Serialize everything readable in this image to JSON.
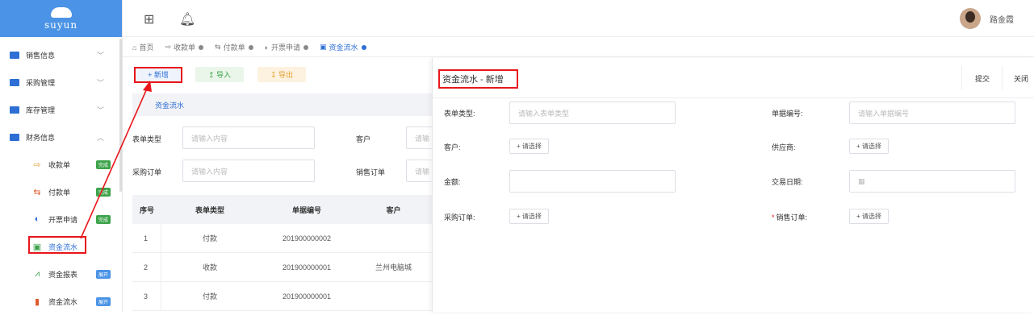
{
  "logo": {
    "text": "suyun"
  },
  "sidebar": {
    "menus": [
      {
        "label": "销售信息",
        "chevron": "﹀"
      },
      {
        "label": "采购管理",
        "chevron": "﹀"
      },
      {
        "label": "库存管理",
        "chevron": "﹀"
      },
      {
        "label": "财务信息",
        "chevron": "︿"
      }
    ],
    "subitems": [
      {
        "label": "收款单",
        "badge": "完成",
        "badge_color": "#3da34a",
        "icon": "receipt-icon",
        "icon_color": "#e3a030"
      },
      {
        "label": "付款单",
        "badge": "完成",
        "badge_color": "#3da34a",
        "icon": "payment-icon",
        "icon_color": "#e05a2b"
      },
      {
        "label": "开票申请",
        "badge": "完成",
        "badge_color": "#3da34a",
        "icon": "invoice-icon",
        "icon_color": "#2d6fd4"
      },
      {
        "label": "资金流水",
        "badge": "",
        "badge_color": "",
        "icon": "flow-icon",
        "icon_color": "#3da34a"
      },
      {
        "label": "资金报表",
        "badge": "展开",
        "badge_color": "#4b93e6",
        "icon": "chart-line-icon",
        "icon_color": "#3da34a"
      },
      {
        "label": "资金流水",
        "badge": "展开",
        "badge_color": "#4b93e6",
        "icon": "chart-bar-icon",
        "icon_color": "#e05a2b"
      }
    ]
  },
  "topbar": {
    "username": "路金霞"
  },
  "tabs": [
    {
      "label": "首页",
      "icon": "⌂",
      "closable": false
    },
    {
      "label": "收款单",
      "icon": "⇨",
      "closable": true
    },
    {
      "label": "付款单",
      "icon": "⇆",
      "closable": true
    },
    {
      "label": "开票申请",
      "icon": "◐",
      "closable": true
    },
    {
      "label": "资金流水",
      "icon": "▣",
      "closable": true,
      "active": true
    }
  ],
  "toolbar": {
    "new_label": "+ 新增",
    "import_label": "↥ 导入",
    "export_label": "↧ 导出"
  },
  "section": {
    "title": "资金流水"
  },
  "filters": {
    "type_label": "表单类型",
    "type_placeholder": "请输入内容",
    "customer_label": "客户",
    "customer_placeholder": "请输",
    "po_label": "采购订单",
    "po_placeholder": "请输入内容",
    "so_label": "销售订单",
    "so_placeholder": "请输"
  },
  "table": {
    "headers": [
      "序号",
      "表单类型",
      "单据编号",
      "客户"
    ],
    "rows": [
      [
        "1",
        "付款",
        "201900000002",
        ""
      ],
      [
        "2",
        "收款",
        "201900000001",
        "兰州电脑城"
      ],
      [
        "3",
        "付款",
        "201900000001",
        ""
      ]
    ]
  },
  "dialog": {
    "title": "资金流水 - 新增",
    "submit_label": "提交",
    "close_label": "关闭",
    "fields": {
      "form_type_label": "表单类型:",
      "form_type_placeholder": "请输入表单类型",
      "doc_no_label": "单据编号:",
      "doc_no_placeholder": "请输入单据编号",
      "customer_label": "客户:",
      "supplier_label": "供应商:",
      "amount_label": "金额:",
      "date_label": "交易日期:",
      "po_label": "采购订单:",
      "so_label": "销售订单:",
      "so_required": "*",
      "pick_label": "+ 请选择"
    }
  },
  "colors": {
    "accent": "#2d6fd4",
    "annotation": "#e8161b"
  }
}
